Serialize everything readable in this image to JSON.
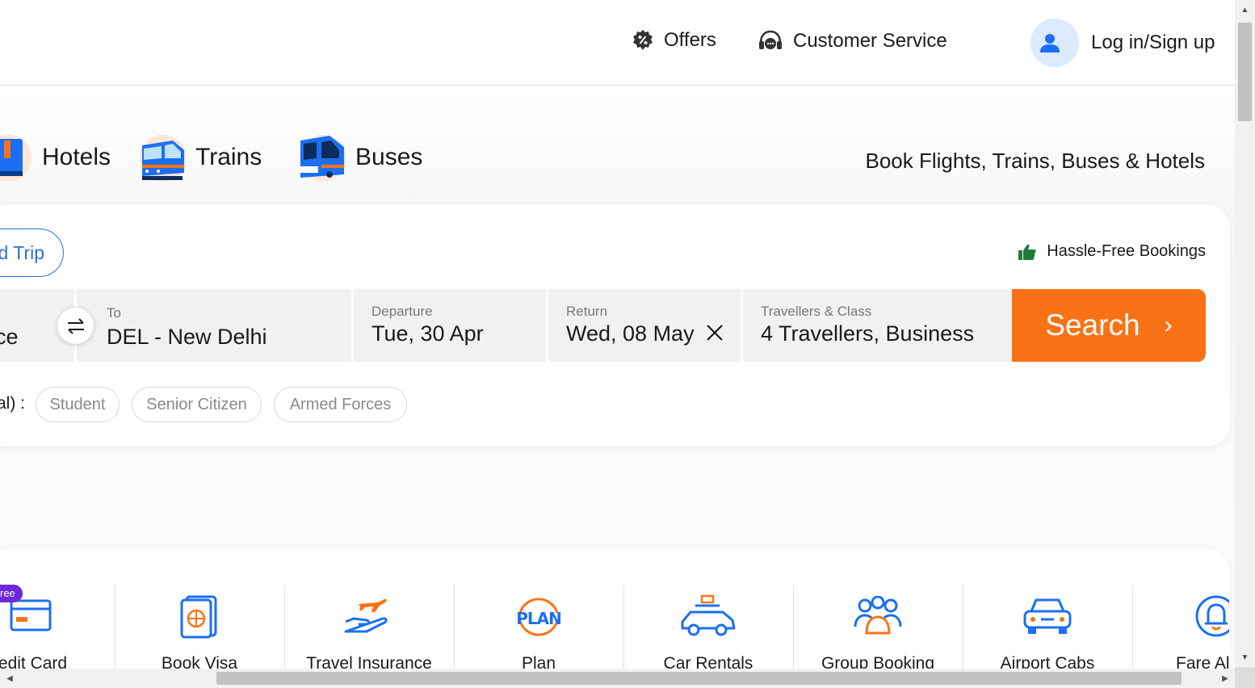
{
  "header": {
    "offers_label": "Offers",
    "customer_service_label": "Customer Service",
    "login_label": "Log in/Sign up"
  },
  "tabs": [
    {
      "label": "Hotels",
      "icon": "hotel-icon"
    },
    {
      "label": "Trains",
      "icon": "train-icon"
    },
    {
      "label": "Buses",
      "icon": "bus-icon"
    }
  ],
  "tagline": "Book Flights, Trains, Buses & Hotels",
  "search": {
    "trip_type_visible": "d Trip",
    "hassle_free": "Hassle-Free Bookings",
    "from_value_partial": "ce",
    "to_label": "To",
    "to_value": "DEL - New Delhi",
    "departure_label": "Departure",
    "departure_value": "Tue, 30 Apr",
    "return_label": "Return",
    "return_value": "Wed, 08 May",
    "travellers_label": "Travellers & Class",
    "travellers_value": "4 Travellers, Business",
    "search_button": "Search",
    "special_fare_label_partial": "al) :",
    "special_fares": [
      "Student",
      "Senior Citizen",
      "Armed Forces"
    ]
  },
  "services": {
    "badge": "ree",
    "items": [
      {
        "label": "redit Card",
        "icon": "credit-card-icon"
      },
      {
        "label": "Book Visa",
        "icon": "passport-icon"
      },
      {
        "label": "Travel Insurance",
        "icon": "insurance-icon"
      },
      {
        "label": "Plan",
        "icon": "plan-icon"
      },
      {
        "label": "Car Rentals",
        "icon": "car-rental-icon"
      },
      {
        "label": "Group Booking",
        "icon": "group-icon"
      },
      {
        "label": "Airport Cabs",
        "icon": "cab-icon"
      },
      {
        "label": "Fare Al",
        "icon": "bell-icon"
      }
    ]
  },
  "colors": {
    "accent_orange": "#f97316",
    "primary_blue": "#2f6fd6",
    "badge_purple": "#6d28d9",
    "thumbs_green": "#1f7a3a"
  }
}
